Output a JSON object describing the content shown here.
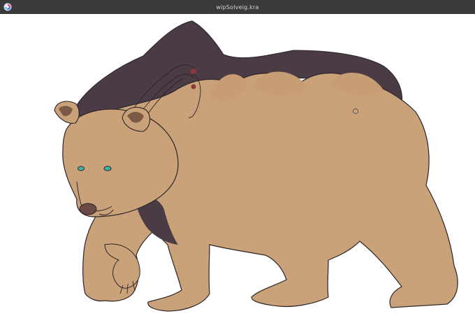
{
  "window": {
    "title": "wipSolveig.kra",
    "app_icon": "krita-icon"
  },
  "canvas": {
    "artwork": "bear-illustration",
    "colors": {
      "fur": "#caa27a",
      "dark_fur": "#4b3b45",
      "outline": "#2c2428",
      "nose": "#6b4a46",
      "eye": "#3fb3a3",
      "ear_inner": "#7a5a44"
    },
    "cursor_icon": "brush-outline-cursor"
  }
}
